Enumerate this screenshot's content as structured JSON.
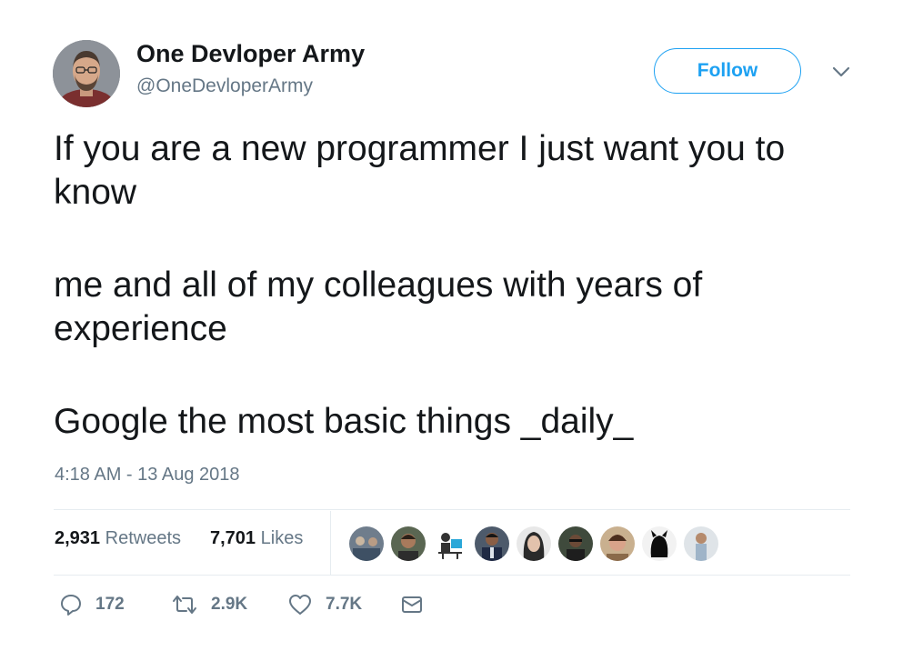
{
  "author": {
    "display_name": "One Devloper Army",
    "handle": "@OneDevloperArmy"
  },
  "follow_button": {
    "label": "Follow"
  },
  "tweet": {
    "paragraphs": [
      "If you are a new programmer I just want you to know",
      "me and all of my colleagues with years of experience",
      "Google the most basic things _daily_"
    ],
    "timestamp": "4:18 AM - 13 Aug 2018"
  },
  "stats": {
    "retweets": {
      "count": "2,931",
      "label": "Retweets"
    },
    "likes": {
      "count": "7,701",
      "label": "Likes"
    },
    "liker_avatar_count": 9
  },
  "actions": {
    "reply": {
      "icon": "reply-icon",
      "count": "172"
    },
    "retweet": {
      "icon": "retweet-icon",
      "count": "2.9K"
    },
    "like": {
      "icon": "heart-icon",
      "count": "7.7K"
    },
    "dm": {
      "icon": "envelope-icon"
    }
  },
  "colors": {
    "brand_blue": "#1da1f2",
    "secondary_text": "#657786",
    "primary_text": "#14171a",
    "divider": "#e6ecf0"
  }
}
